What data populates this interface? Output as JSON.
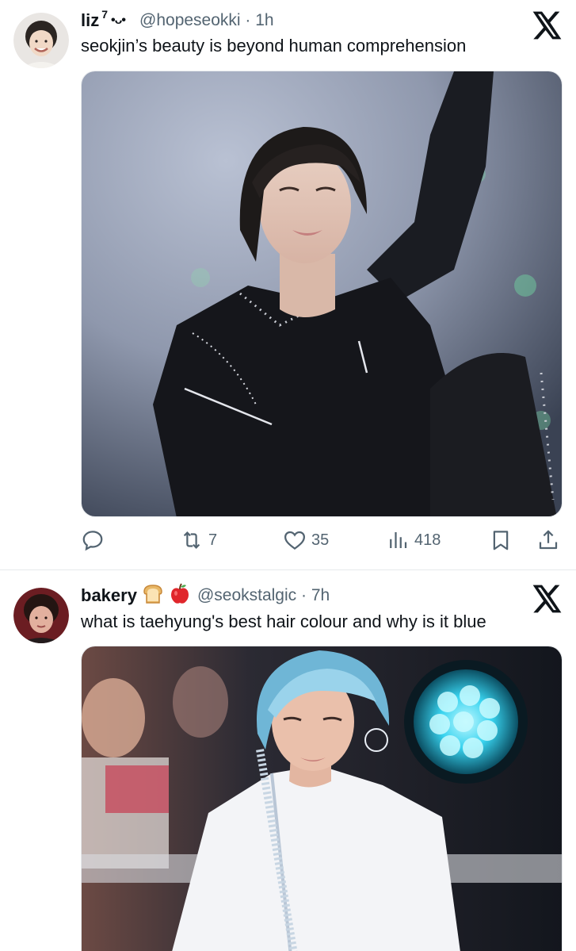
{
  "tweets": [
    {
      "display_name": "liz",
      "badge": "7",
      "kaomoji": "•ᴗ•",
      "handle_time": "@hopeseokki · 1h",
      "text": "seokjin’s beauty is beyond human comprehension",
      "media_icon": "photo-of-performer-in-black-studded-outfit",
      "actions": {
        "reply_count": "",
        "retweet_count": "7",
        "like_count": "35",
        "views_count": "418"
      }
    },
    {
      "display_name": "bakery",
      "emojis": [
        "bread-emoji",
        "apple-emoji"
      ],
      "handle_time": "@seokstalgic · 7h",
      "text": "what is taehyung's best hair colour and why is it blue",
      "media_icon": "photo-of-performer-with-blue-hair"
    }
  ],
  "icons": {
    "reply": "reply-icon",
    "retweet": "retweet-icon",
    "like": "heart-icon",
    "views": "views-icon",
    "bookmark": "bookmark-icon",
    "share": "share-icon",
    "logo": "x-logo-icon"
  },
  "colors": {
    "text": "#0f1419",
    "secondary": "#536471",
    "divider": "#e6e9ec"
  }
}
